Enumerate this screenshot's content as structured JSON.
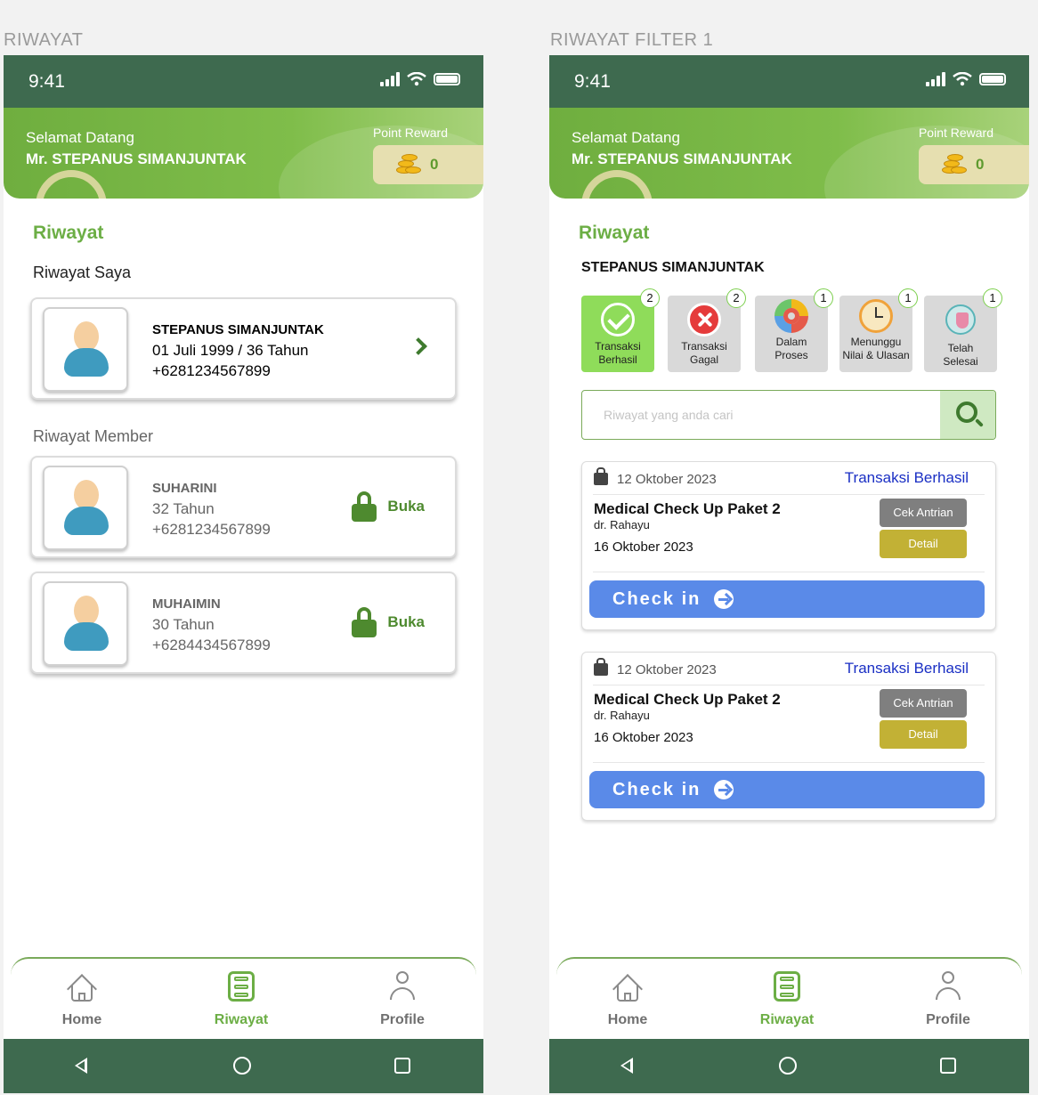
{
  "frames": [
    "RIWAYAT",
    "RIWAYAT FILTER 1"
  ],
  "status_time": "9:41",
  "header": {
    "greeting": "Selamat Datang",
    "user_name": "Mr. STEPANUS SIMANJUNTAK",
    "point_label": "Point Reward",
    "point_value": "0"
  },
  "section_title": "Riwayat",
  "screen1": {
    "my_history_title": "Riwayat Saya",
    "me": {
      "name": "STEPANUS SIMANJUNTAK",
      "dob_age": "01 Juli 1999 / 36 Tahun",
      "phone": "+6281234567899"
    },
    "member_title": "Riwayat Member",
    "members": [
      {
        "name": "SUHARINI",
        "age": "32 Tahun",
        "phone": "+6281234567899",
        "action": "Buka"
      },
      {
        "name": "MUHAIMIN",
        "age": "30 Tahun",
        "phone": "+6284434567899",
        "action": "Buka"
      }
    ]
  },
  "screen2": {
    "user_name": "STEPANUS SIMANJUNTAK",
    "filters": [
      {
        "label1": "Transaksi",
        "label2": "Berhasil",
        "count": "2",
        "icon": "check-circle-icon",
        "active": true
      },
      {
        "label1": "Transaksi",
        "label2": "Gagal",
        "count": "2",
        "icon": "x-circle-icon",
        "active": false
      },
      {
        "label1": "Dalam",
        "label2": "Proses",
        "count": "1",
        "icon": "gear-icon",
        "active": false
      },
      {
        "label1": "Menunggu",
        "label2": "Nilai & Ulasan",
        "count": "1",
        "icon": "clock-icon",
        "active": false
      },
      {
        "label1": "Telah",
        "label2": "Selesai",
        "count": "1",
        "icon": "shield-icon",
        "active": false
      }
    ],
    "search_placeholder": "Riwayat yang anda cari",
    "transactions": [
      {
        "date": "12 Oktober 2023",
        "status": "Transaksi Berhasil",
        "package": "Medical Check Up Paket 2",
        "doctor": "dr. Rahayu",
        "visit_date": "16 Oktober 2023",
        "queue_label": "Cek Antrian",
        "detail_label": "Detail",
        "checkin_label": "Check in"
      },
      {
        "date": "12 Oktober 2023",
        "status": "Transaksi Berhasil",
        "package": "Medical Check Up Paket 2",
        "doctor": "dr. Rahayu",
        "visit_date": "16 Oktober 2023",
        "queue_label": "Cek Antrian",
        "detail_label": "Detail",
        "checkin_label": "Check in"
      }
    ]
  },
  "nav": {
    "home": "Home",
    "history": "Riwayat",
    "profile": "Profile"
  },
  "colors": {
    "primary_dark": "#3e6a4f",
    "accent_green": "#6cae45",
    "checkin_blue": "#5a8ae8",
    "status_blue": "#1a2fc4",
    "detail_gold": "#c2b135"
  }
}
